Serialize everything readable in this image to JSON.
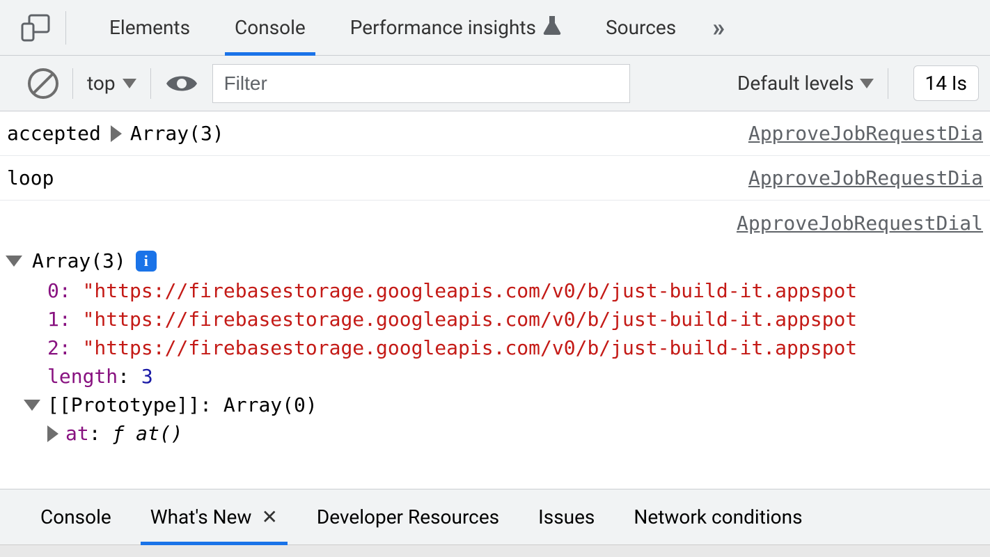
{
  "topTabs": {
    "elements": "Elements",
    "console": "Console",
    "perfInsights": "Performance insights",
    "sources": "Sources"
  },
  "toolbar": {
    "contextLabel": "top",
    "filterPlaceholder": "Filter",
    "levelsLabel": "Default levels",
    "issuesLabel": "14 Is"
  },
  "log": {
    "row0": {
      "label": "accepted",
      "summary": "Array(3)",
      "source": "ApproveJobRequestDia"
    },
    "row1": {
      "label": "loop",
      "source": "ApproveJobRequestDia"
    },
    "row2": {
      "source": "ApproveJobRequestDial"
    }
  },
  "array": {
    "summary": "Array(3)",
    "items": {
      "i0": {
        "idx": "0",
        "val": "\"https://firebasestorage.googleapis.com/v0/b/just-build-it.appspot"
      },
      "i1": {
        "idx": "1",
        "val": "\"https://firebasestorage.googleapis.com/v0/b/just-build-it.appspot"
      },
      "i2": {
        "idx": "2",
        "val": "\"https://firebasestorage.googleapis.com/v0/b/just-build-it.appspot"
      }
    },
    "lengthLabel": "length",
    "lengthValue": "3",
    "protoLabel": "[[Prototype]]",
    "protoValue": "Array(0)",
    "atLabel": "at",
    "atFn": "ƒ at()"
  },
  "drawer": {
    "console": "Console",
    "whatsNew": "What's New",
    "devResources": "Developer Resources",
    "issues": "Issues",
    "network": "Network conditions"
  },
  "infoBadge": "i"
}
